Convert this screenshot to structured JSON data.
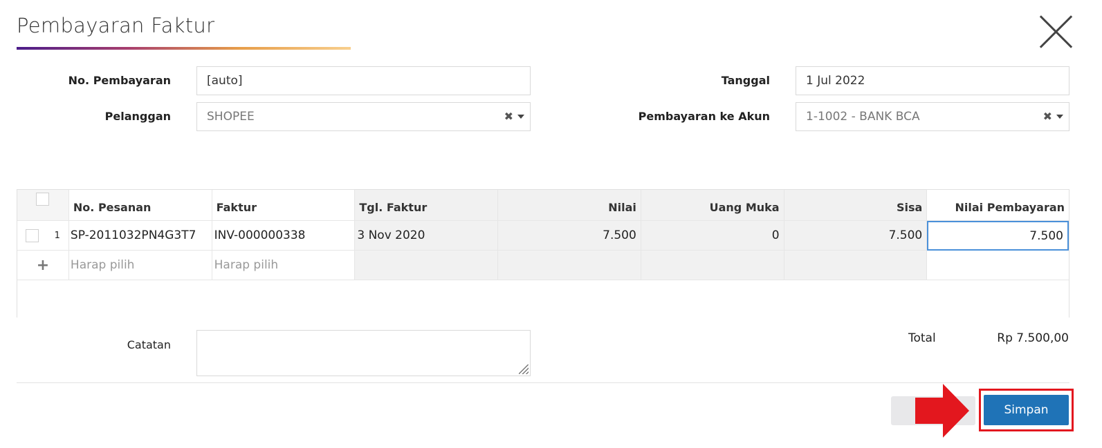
{
  "dialog": {
    "title": "Pembayaran Faktur"
  },
  "form": {
    "payment_no": {
      "label": "No. Pembayaran",
      "value": "[auto]"
    },
    "customer": {
      "label": "Pelanggan",
      "value": "SHOPEE"
    },
    "date": {
      "label": "Tanggal",
      "value": "1 Jul 2022"
    },
    "account": {
      "label": "Pembayaran ke Akun",
      "value": "1-1002 - BANK BCA"
    }
  },
  "table": {
    "headers": {
      "order_no": "No. Pesanan",
      "invoice": "Faktur",
      "invoice_date": "Tgl. Faktur",
      "amount": "Nilai",
      "down_payment": "Uang Muka",
      "remaining": "Sisa",
      "payment_amount": "Nilai Pembayaran"
    },
    "rows": [
      {
        "number": "1",
        "order_no": "SP-2011032PN4G3T7",
        "invoice": "INV-000000338",
        "invoice_date": "3 Nov 2020",
        "amount": "7.500",
        "down_payment": "0",
        "remaining": "7.500",
        "payment_amount": "7.500"
      }
    ],
    "new_row": {
      "add_icon": "+",
      "order_placeholder": "Harap pilih",
      "invoice_placeholder": "Harap pilih"
    }
  },
  "notes": {
    "label": "Catatan",
    "value": ""
  },
  "totals": {
    "label": "Total",
    "value": "Rp 7.500,00"
  },
  "actions": {
    "save_label": "Simpan"
  },
  "colors": {
    "primary": "#1f73b7",
    "highlight": "#e3171e"
  }
}
